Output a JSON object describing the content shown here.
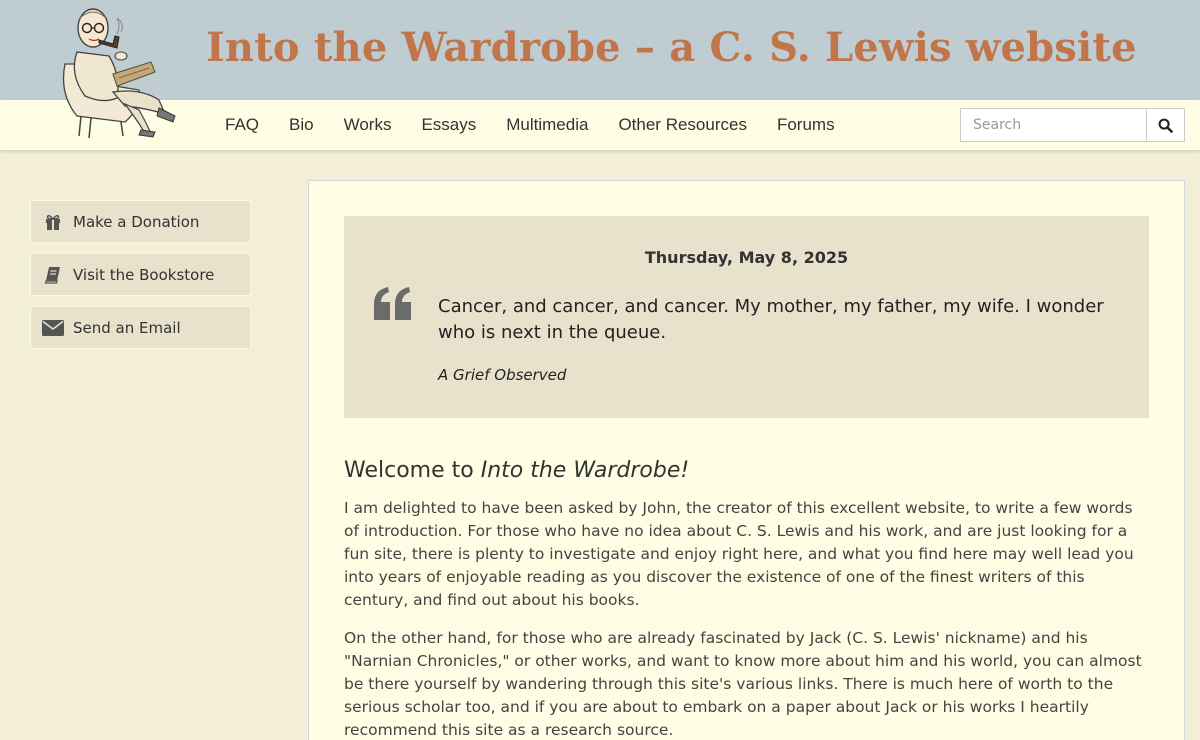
{
  "site": {
    "title": "Into the Wardrobe – a C. S. Lewis website"
  },
  "nav": {
    "items": [
      {
        "label": "FAQ"
      },
      {
        "label": "Bio"
      },
      {
        "label": "Works"
      },
      {
        "label": "Essays"
      },
      {
        "label": "Multimedia"
      },
      {
        "label": "Other Resources"
      },
      {
        "label": "Forums"
      }
    ]
  },
  "search": {
    "placeholder": "Search",
    "value": "",
    "icon": "search-icon"
  },
  "sidebar": {
    "items": [
      {
        "label": "Make a Donation",
        "icon": "gift-icon"
      },
      {
        "label": "Visit the Bookstore",
        "icon": "book-icon"
      },
      {
        "label": "Send an Email",
        "icon": "envelope-icon"
      }
    ]
  },
  "quote": {
    "date": "Thursday, May 8, 2025",
    "text": "Cancer, and cancer, and cancer. My mother, my father, my wife. I wonder who is next in the queue.",
    "source": "A Grief Observed"
  },
  "welcome": {
    "heading_prefix": "Welcome to ",
    "heading_italic": "Into the Wardrobe!",
    "paragraphs": [
      "I am delighted to have been asked by John, the creator of this excellent website, to write a few words of introduction. For those who have no idea about C. S. Lewis and his work, and are just looking for a fun site, there is plenty to investigate and enjoy right here, and what you find here may well lead you into years of enjoyable reading as you discover the existence of one of the finest writers of this century, and find out about his books.",
      "On the other hand, for those who are already fascinated by Jack (C. S. Lewis' nickname) and his \"Narnian Chronicles,\" or other works, and want to know more about him and his world, you can almost be there yourself by wandering through this site's various links. There is much here of worth to the serious scholar too, and if you are about to embark on a paper about Jack or his works I heartily recommend this site as a research source."
    ]
  },
  "colors": {
    "banner": "#bfccd2",
    "title": "#c0754a",
    "navbar": "#fefee4",
    "page": "#f3eed6",
    "quote_box": "#e8e1cc"
  }
}
